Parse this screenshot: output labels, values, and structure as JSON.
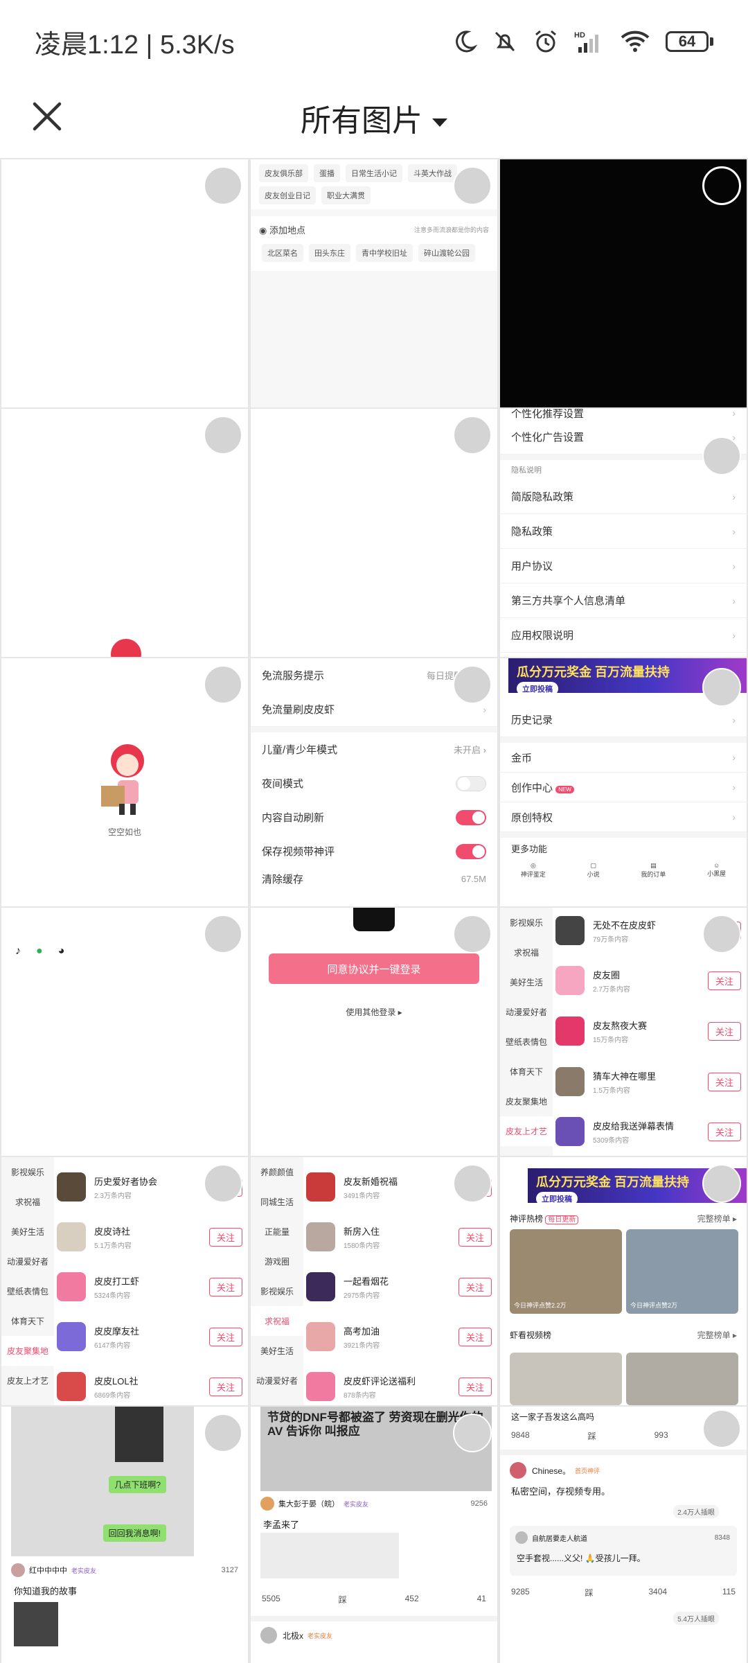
{
  "status_bar": {
    "time": "凌晨1:12 | 5.3K/s",
    "battery": "64",
    "icons": [
      "moon-icon",
      "mute-bell-icon",
      "alarm-icon",
      "hd-signal-icon",
      "wifi-icon",
      "battery-icon"
    ]
  },
  "header": {
    "title": "所有图片",
    "close_icon": "close-icon"
  },
  "accent_color": "#f14b6e",
  "cells": {
    "c2": {
      "tags_row1": [
        "皮友俱乐部",
        "蛋播",
        "日常生活小记",
        "斗英大作战"
      ],
      "tags_row2": [
        "皮友创业日记",
        "职业大满贯"
      ],
      "add_location": "添加地点",
      "location_note": "注意多而流浪都是你的内容",
      "locations": [
        "北区菜名",
        "田头东庄",
        "青中学校旧址",
        "碎山渡轮公园"
      ]
    },
    "c6": {
      "top_row": "个性化推荐设置",
      "rows": [
        "个性化广告设置"
      ],
      "section": "隐私说明",
      "rows2": [
        "简版隐私政策",
        "隐私政策",
        "用户协议",
        "第三方共享个人信息清单",
        "应用权限说明"
      ]
    },
    "c7": {
      "empty_text": "空空如也"
    },
    "c8": {
      "row1_label": "免流服务提示",
      "row1_value": "每日提醒一次",
      "row2_label": "免流量刷皮皮虾",
      "row3_label": "儿童/青少年模式",
      "row3_value": "未开启",
      "row4_label": "夜间模式",
      "row5_label": "内容自动刷新",
      "row6_label": "保存视频带神评",
      "row7_label": "清除缓存",
      "row7_value": "67.5M"
    },
    "c9": {
      "banner_title": "瓜分万元奖金 百万流量扶持",
      "banner_button": "立即投稿",
      "rows": [
        "历史记录",
        "金币",
        "创作中心",
        "原创特权"
      ],
      "new_badge": "NEW",
      "more": "更多功能",
      "icons": [
        "神评鉴定",
        "小说",
        "我的订单",
        "小黑屋"
      ]
    },
    "c11": {
      "login_button": "同意协议并一键登录",
      "other_login": "使用其他登录 ▸"
    },
    "c12": {
      "categories": [
        "影视娱乐",
        "求祝福",
        "美好生活",
        "动漫爱好者",
        "壁纸表情包",
        "体育天下",
        "皮友聚集地",
        "皮友上才艺"
      ],
      "users": [
        {
          "name": "无处不在皮皮虾",
          "sub": "79万条内容"
        },
        {
          "name": "皮友圈",
          "sub": "2.7万条内容"
        },
        {
          "name": "皮友熬夜大赛",
          "sub": "15万条内容"
        },
        {
          "name": "猜车大神在哪里",
          "sub": "1.5万条内容"
        },
        {
          "name": "皮皮给我送弹幕表情",
          "sub": "5309条内容"
        }
      ],
      "follow": "关注"
    },
    "c13": {
      "categories": [
        "影视娱乐",
        "求祝福",
        "美好生活",
        "动漫爱好者",
        "壁纸表情包",
        "体育天下",
        "皮友聚集地",
        "皮友上才艺"
      ],
      "users": [
        {
          "name": "历史爱好者协会",
          "sub": "2.3万条内容"
        },
        {
          "name": "皮皮诗社",
          "sub": "5.1万条内容"
        },
        {
          "name": "皮皮打工虾",
          "sub": "5324条内容"
        },
        {
          "name": "皮皮摩友社",
          "sub": "6147条内容"
        },
        {
          "name": "皮皮LOL社",
          "sub": "6869条内容"
        }
      ],
      "follow": "关注"
    },
    "c14": {
      "categories": [
        "养颜颜值",
        "同城生活",
        "正能量",
        "游戏圈",
        "影视娱乐",
        "求祝福",
        "美好生活",
        "动漫爱好者"
      ],
      "users": [
        {
          "name": "皮友新婚祝福",
          "sub": "3491条内容"
        },
        {
          "name": "新房入住",
          "sub": "1580条内容"
        },
        {
          "name": "一起看烟花",
          "sub": "2975条内容"
        },
        {
          "name": "高考加油",
          "sub": "3921条内容"
        },
        {
          "name": "皮皮虾评论送福利",
          "sub": "878条内容"
        }
      ],
      "follow": "关注"
    },
    "c15": {
      "banner_title": "瓜分万元奖金 百万流量扶持",
      "banner_button": "立即投稿",
      "hot_title": "神评热榜",
      "hot_badge": "每日更新",
      "hot_more": "完整榜单 ▸",
      "thumb1": "今日神评点赞2.2万",
      "thumb2": "今日神评点赞2万",
      "video_title": "虾看视频榜",
      "video_more": "完整榜单 ▸"
    },
    "c16": {
      "bubble1": "几点下班啊?",
      "bubble2": "回回我消息啊!",
      "user": "红中中中中",
      "badge": "老实皮友",
      "likes": "3127",
      "caption": "你知道我的故事"
    },
    "c17": {
      "overlay_text": "节贷的DNF号都被盗了 劳资现在删光你的AV 告诉你 叫报应",
      "user": "集大彭于晏（皖）",
      "badge": "老实皮友",
      "likes": "9256",
      "caption": "李孟来了",
      "stats": [
        "5505",
        "踩",
        "452",
        "41"
      ],
      "next_user": "北极x",
      "next_badge": "老实皮友"
    },
    "c18": {
      "caption_top": "这一家子吾发这么高吗",
      "stats1": [
        "9848",
        "踩",
        "993",
        "67"
      ],
      "user": "Chinese。",
      "badge": "首页神评",
      "post_text": "私密空间，存视频专用。",
      "viewers": "2.4万人插眼",
      "comment_user": "自航居要走人航道",
      "comment_likes": "8348",
      "comment_text": "空手套视......义父! 🙏受孩儿一拜。",
      "stats2": [
        "9285",
        "踩",
        "3404",
        "115"
      ],
      "viewers2": "5.4万人插眼"
    }
  }
}
